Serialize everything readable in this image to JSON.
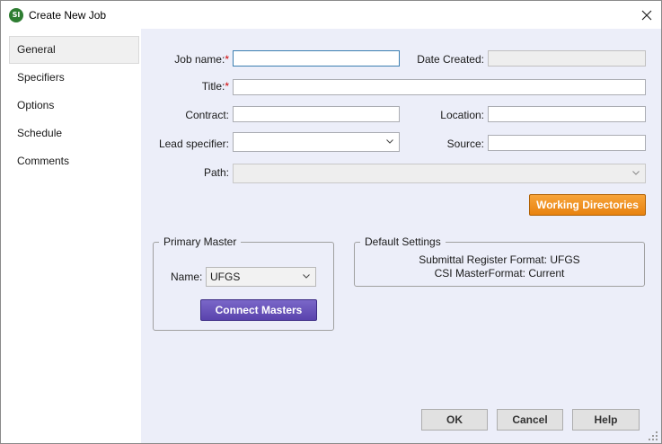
{
  "window": {
    "title": "Create New Job",
    "app_icon_text": "SI"
  },
  "sidebar": {
    "items": [
      {
        "label": "General",
        "selected": true
      },
      {
        "label": "Specifiers"
      },
      {
        "label": "Options"
      },
      {
        "label": "Schedule"
      },
      {
        "label": "Comments"
      }
    ]
  },
  "form": {
    "job_name": {
      "label": "Job name:",
      "required": "*",
      "value": ""
    },
    "date_created": {
      "label": "Date Created:",
      "value": ""
    },
    "title": {
      "label": "Title:",
      "required": "*",
      "value": ""
    },
    "contract": {
      "label": "Contract:",
      "value": ""
    },
    "location": {
      "label": "Location:",
      "value": ""
    },
    "lead_specifier": {
      "label": "Lead specifier:",
      "value": ""
    },
    "source": {
      "label": "Source:",
      "value": ""
    },
    "path": {
      "label": "Path:",
      "value": ""
    },
    "working_directories_label": "Working Directories"
  },
  "primary_master": {
    "legend": "Primary Master",
    "name_label": "Name:",
    "name_value": "UFGS",
    "connect_label": "Connect Masters"
  },
  "default_settings": {
    "legend": "Default Settings",
    "line1": "Submittal Register Format: UFGS",
    "line2": "CSI MasterFormat: Current"
  },
  "footer": {
    "ok_label": "OK",
    "cancel_label": "Cancel",
    "help_label": "Help"
  },
  "colors": {
    "orange": "#f0901c",
    "purple": "#5a43ad",
    "panel_bg": "#eceef9",
    "required": "#d00000"
  }
}
